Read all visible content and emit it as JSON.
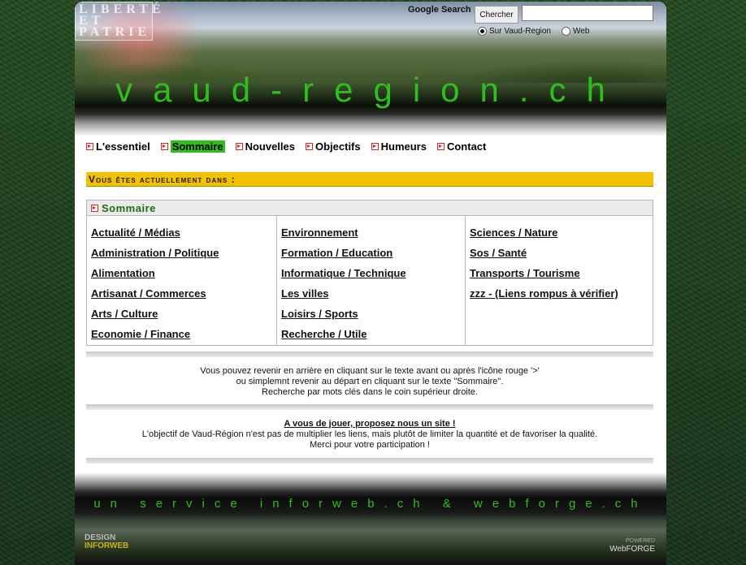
{
  "header": {
    "logo_lines": [
      "LIBERTÉ",
      "ET",
      "PATRIE"
    ],
    "site_title": "vaud-region.ch",
    "search": {
      "label": "Google Search",
      "button": "Chercher",
      "value": "",
      "options": [
        {
          "label": "Sur Vaud-Region",
          "selected": true
        },
        {
          "label": "Web",
          "selected": false
        }
      ]
    }
  },
  "nav": {
    "items": [
      {
        "label": "L'essentiel",
        "active": false
      },
      {
        "label": "Sommaire",
        "active": true
      },
      {
        "label": "Nouvelles",
        "active": false
      },
      {
        "label": "Objectifs",
        "active": false
      },
      {
        "label": "Humeurs",
        "active": false
      },
      {
        "label": "Contact",
        "active": false
      }
    ]
  },
  "location": {
    "label": "Vous êtes actuellement dans :"
  },
  "categories": {
    "heading": "Sommaire",
    "columns": [
      [
        "Actualité / Médias",
        "Administration / Politique",
        "Alimentation",
        "Artisanat / Commerces",
        "Arts / Culture",
        "Economie / Finance"
      ],
      [
        "Environnement",
        "Formation / Education",
        "Informatique / Technique",
        "Les villes",
        "Loisirs / Sports",
        "Recherche / Utile"
      ],
      [
        "Sciences / Nature",
        "Sos / Santé",
        "Transports / Tourisme",
        "zzz - (Liens rompus à vérifier)"
      ]
    ]
  },
  "help": {
    "lines": [
      "Vous pouvez revenir en arrière en cliquant sur le texte avant ou après l'icône rouge '>'",
      "ou simplemnt revenir au départ en cliquant sur le texte \"Sommaire\".",
      "Recherche par mots clés dans le coin supérieur droite."
    ]
  },
  "promo": {
    "title": "A vous de jouer, proposez nous un site !",
    "lines": [
      "L'objectif de Vaud-Région n'est pas de multiplier les liens, mais plutôt de limiter la quantité et de favoriser la qualité.",
      "Merci pour votre participation !"
    ]
  },
  "footer": {
    "service_line": "un service inforweb.ch & webforge.ch",
    "logo_left": {
      "line1": "DESIGN",
      "line2": "INFORWEB"
    },
    "logo_right": {
      "small": "POWERED",
      "main": "WebFORGE"
    }
  },
  "colors": {
    "accent_green": "#2fbf1c",
    "location_bar": "#f2c200",
    "nav_marker": "#dd2222"
  }
}
